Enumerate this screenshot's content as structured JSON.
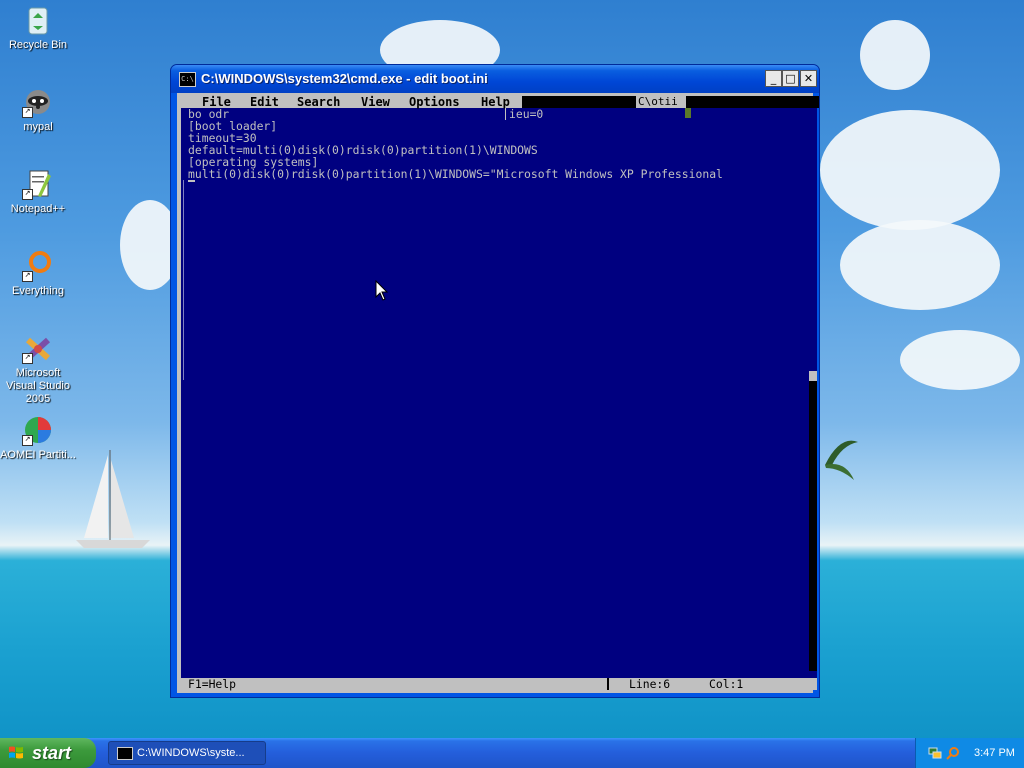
{
  "desktop": {
    "icons": [
      {
        "label": "Recycle Bin",
        "icon": "recycle-bin-icon"
      },
      {
        "label": "mypal",
        "icon": "raccoon-icon"
      },
      {
        "label": "Notepad++",
        "icon": "notepad-plus-plus-icon"
      },
      {
        "label": "Everything",
        "icon": "everything-search-icon"
      },
      {
        "label": "Microsoft Visual Studio 2005",
        "icon": "visual-studio-icon"
      },
      {
        "label": "AOMEI Partiti...",
        "icon": "aomei-partition-icon"
      }
    ]
  },
  "window": {
    "title": "C:\\WINDOWS\\system32\\cmd.exe - edit boot.ini",
    "minimize": "_",
    "maximize": "□",
    "close": "✕"
  },
  "editor": {
    "menu": [
      "File",
      "Edit",
      "Search",
      "View",
      "Options",
      "Help"
    ],
    "menu_path": "C\\otii",
    "lines": [
      "bo odr",
      "[boot loader]",
      "timeout=30",
      "default=multi(0)disk(0)rdisk(0)partition(1)\\WINDOWS",
      "[operating systems]",
      "multi(0)disk(0)rdisk(0)partition(1)\\WINDOWS=\"Microsoft Windows XP Professional"
    ],
    "ghost_text": "ieu=0",
    "status": {
      "help": "F1=Help",
      "line": "Line:6",
      "col": "Col:1"
    }
  },
  "taskbar": {
    "start_label": "start",
    "task_label": "C:\\WINDOWS\\syste...",
    "clock": "3:47 PM"
  },
  "colors": {
    "editor_bg": "#000080",
    "editor_text": "#c0c0c0",
    "titlebar": "#0046d6",
    "start_green": "#3c9a3c",
    "taskbar_blue": "#245edb"
  }
}
